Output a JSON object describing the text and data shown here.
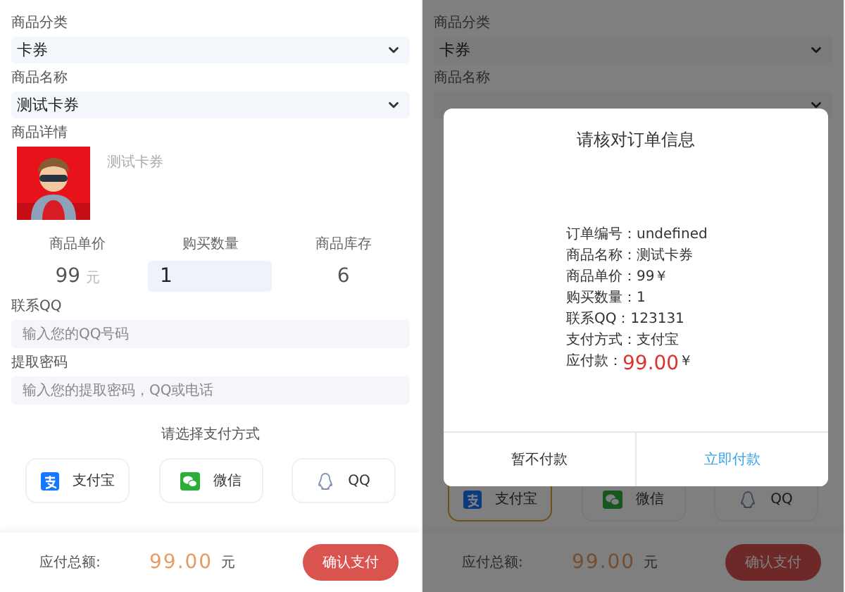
{
  "order_form": {
    "category": {
      "label": "商品分类",
      "value": "卡券"
    },
    "product": {
      "label": "商品名称",
      "value": "测试卡券"
    },
    "details": {
      "label": "商品详情",
      "description": "测试卡券"
    },
    "stats": {
      "price": {
        "label": "商品单价",
        "value": "99",
        "unit": "元"
      },
      "quantity": {
        "label": "购买数量",
        "value": "1"
      },
      "stock": {
        "label": "商品库存",
        "value": "6"
      }
    },
    "contact_qq": {
      "label": "联系QQ",
      "placeholder": "输入您的QQ号码"
    },
    "pickup_code": {
      "label": "提取密码",
      "placeholder": "输入您的提取密码，QQ或电话"
    },
    "payment": {
      "prompt": "请选择支付方式",
      "methods": [
        {
          "kind": "alipay",
          "label": "支付宝",
          "selected": false
        },
        {
          "kind": "wechat",
          "label": "微信",
          "selected": false
        },
        {
          "kind": "qq",
          "label": "QQ",
          "selected": false
        }
      ]
    },
    "footer": {
      "label": "应付总额:",
      "amount": "99.00",
      "unit": "元",
      "button": "确认支付"
    }
  },
  "confirm_screen": {
    "background": {
      "category": {
        "label": "商品分类",
        "value": "卡券"
      },
      "product": {
        "label": "商品名称"
      },
      "payment": {
        "methods": [
          {
            "kind": "alipay",
            "label": "支付宝",
            "selected": true
          },
          {
            "kind": "wechat",
            "label": "微信",
            "selected": false
          },
          {
            "kind": "qq",
            "label": "QQ",
            "selected": false
          }
        ]
      },
      "footer": {
        "label": "应付总额:",
        "amount": "99.00",
        "unit": "元",
        "button": "确认支付"
      }
    },
    "dialog": {
      "title": "请核对订单信息",
      "lines": [
        {
          "kind": "text",
          "text": "订单编号：undefined"
        },
        {
          "kind": "text",
          "text": "商品名称：测试卡券"
        },
        {
          "kind": "text",
          "text": "商品单价：99￥"
        },
        {
          "kind": "text",
          "text": "购买数量：1"
        },
        {
          "kind": "text",
          "text": "联系QQ：123131"
        },
        {
          "kind": "text",
          "text": "支付方式：支付宝"
        },
        {
          "kind": "amount",
          "label": "应付款：",
          "amount": "99.00",
          "unit": "￥"
        }
      ],
      "buttons": [
        {
          "kind": "cancel",
          "label": "暂不付款"
        },
        {
          "kind": "confirm",
          "label": "立即付款"
        }
      ]
    }
  }
}
